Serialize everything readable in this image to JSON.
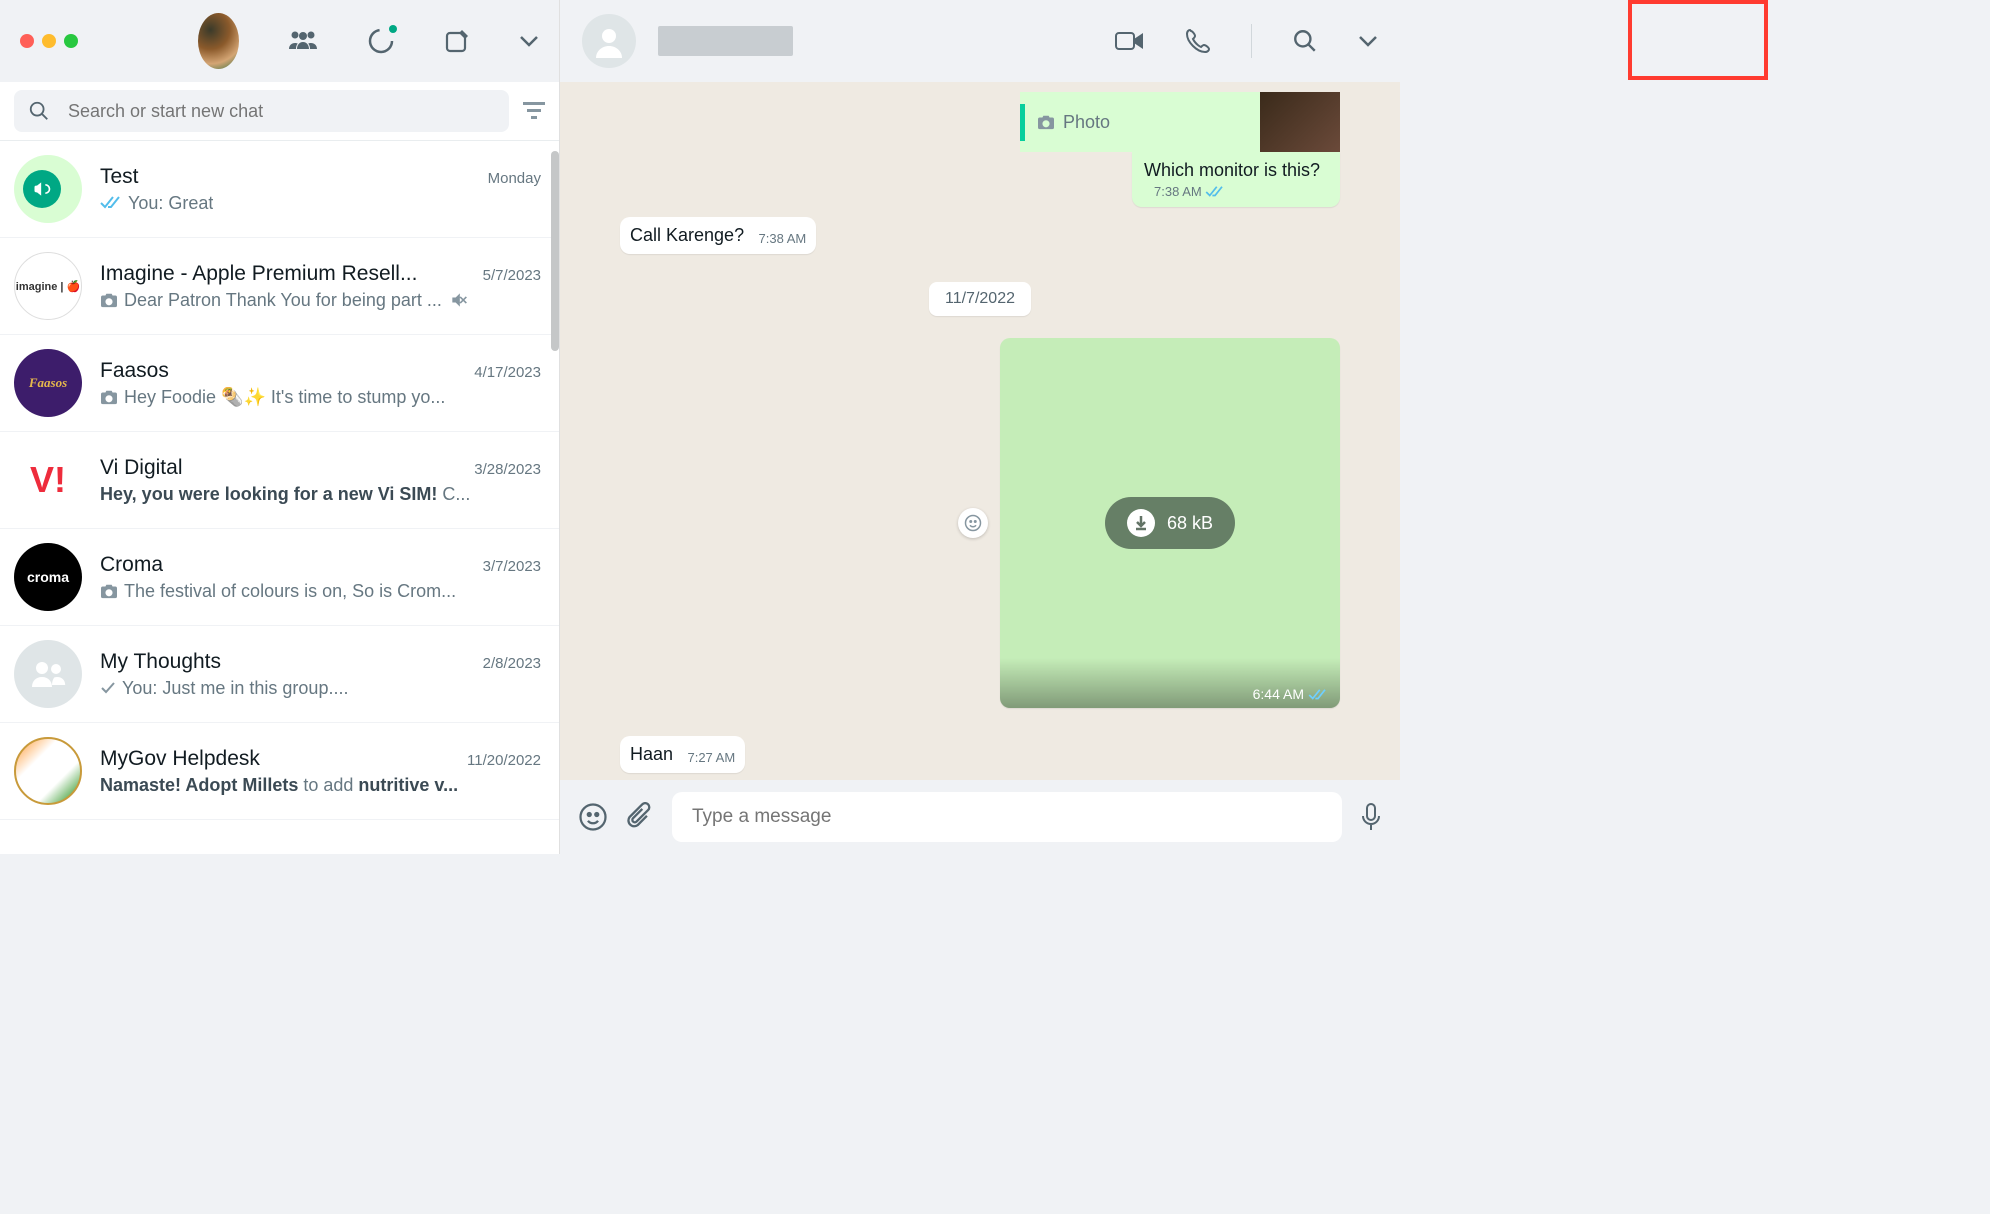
{
  "search": {
    "placeholder": "Search or start new chat"
  },
  "chats": [
    {
      "name": "Test",
      "time": "Monday",
      "preview": "You: Great",
      "check": "read",
      "avatar": "test"
    },
    {
      "name": "Imagine - Apple Premium Resell...",
      "time": "5/7/2023",
      "preview": "Dear Patron Thank You for being part ...",
      "camera": true,
      "muted": true,
      "avatar": "imagine",
      "avatarText": "imagine | 🍎"
    },
    {
      "name": "Faasos",
      "time": "4/17/2023",
      "preview": "Hey Foodie 🌯✨ It's time to stump yo...",
      "camera": true,
      "avatar": "faasos",
      "avatarText": "Faasos"
    },
    {
      "name": "Vi Digital",
      "time": "3/28/2023",
      "previewBold": "Hey, you were looking for a new Vi SIM!",
      "previewTail": " C...",
      "avatar": "vi",
      "avatarText": "V!"
    },
    {
      "name": "Croma",
      "time": "3/7/2023",
      "preview": "The festival of colours is on,  So is Crom...",
      "camera": true,
      "avatar": "croma",
      "avatarText": "croma"
    },
    {
      "name": "My Thoughts",
      "time": "2/8/2023",
      "preview": "You: Just me in this group....",
      "check": "sent",
      "avatar": "group"
    },
    {
      "name": "MyGov Helpdesk",
      "time": "11/20/2022",
      "previewBold": "Namaste! Adopt Millets",
      "previewMid": " to add ",
      "previewBold2": "nutritive v...",
      "avatar": "mygov"
    }
  ],
  "conversation": {
    "photoLabel": "Photo",
    "q1": "Which monitor is this?",
    "q1_time": "7:38 AM",
    "in1": "Call Karenge?",
    "in1_time": "7:38 AM",
    "date": "11/7/2022",
    "img_size": "68 kB",
    "img_time": "6:44 AM",
    "in2": "Haan",
    "in2_time": "7:27 AM"
  },
  "composer": {
    "placeholder": "Type a message"
  }
}
